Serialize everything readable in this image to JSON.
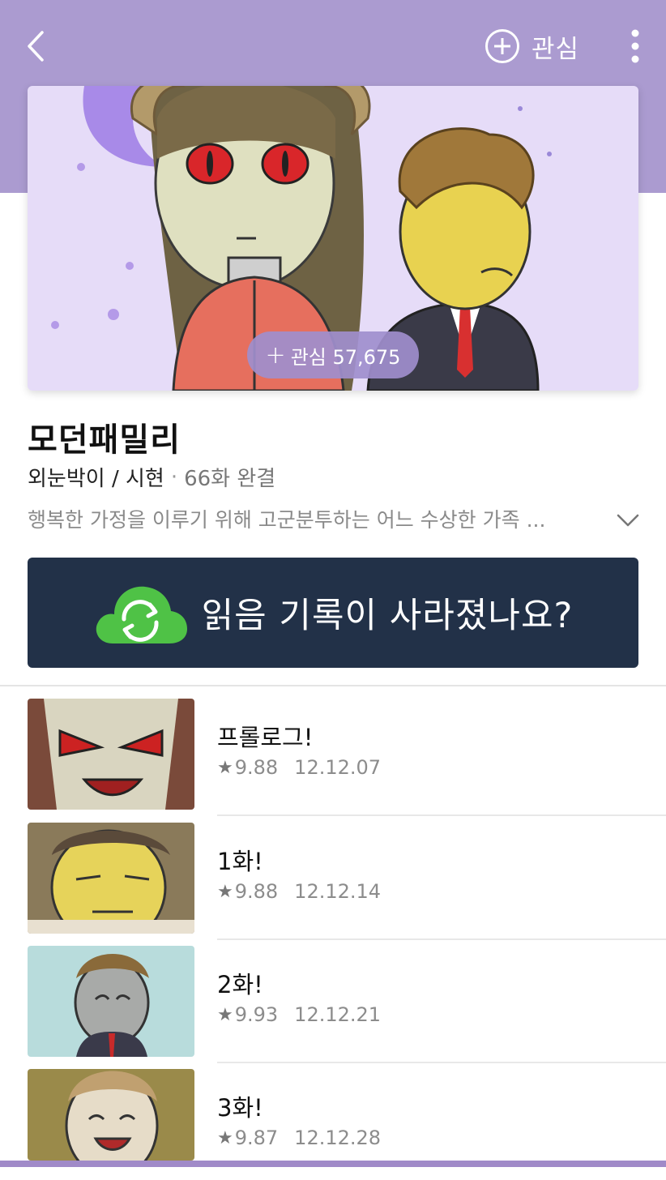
{
  "header": {
    "back_icon": "chevron-left-icon",
    "favorite_label": "관심",
    "favorite_icon": "plus-circle-icon",
    "more_icon": "vertical-dots-icon",
    "bg_color": "#ab9bd0"
  },
  "cover": {
    "favorite_pill": "관심 57,675",
    "favorite_pill_icon": "plus-icon"
  },
  "work": {
    "title": "모던패밀리",
    "authors": "외눈박이 / 시현",
    "separator": "·",
    "episode_status": "66화 완결",
    "description": "행복한 가정을 이루기 위해 고군분투하는 어느 수상한 가족 ...",
    "expand_icon": "chevron-down-icon"
  },
  "banner": {
    "text": "읽음 기록이 사라졌나요?",
    "icon": "cloud-sync-icon",
    "bg_color": "#223148"
  },
  "episodes": [
    {
      "title": "프롤로그!",
      "rating": "9.88",
      "date": "12.12.07"
    },
    {
      "title": "1화!",
      "rating": "9.88",
      "date": "12.12.14"
    },
    {
      "title": "2화!",
      "rating": "9.93",
      "date": "12.12.21"
    },
    {
      "title": "3화!",
      "rating": "9.87",
      "date": "12.12.28"
    }
  ]
}
